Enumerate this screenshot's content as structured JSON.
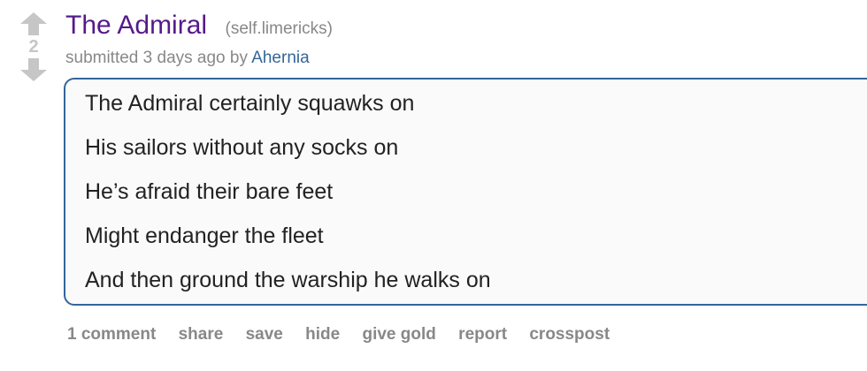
{
  "vote": {
    "score": "2"
  },
  "post": {
    "title": "The Admiral",
    "domain": "(self.limericks)",
    "tagline_prefix": "submitted 3 days ago by ",
    "author": "Ahernia"
  },
  "selftext": {
    "lines": [
      "The Admiral certainly squawks on",
      "His sailors without any socks on",
      "He’s afraid their bare feet",
      "Might endanger the fleet",
      "And then ground the warship he walks on"
    ]
  },
  "buttons": {
    "comments": "1 comment",
    "share": "share",
    "save": "save",
    "hide": "hide",
    "give_gold": "give gold",
    "report": "report",
    "crosspost": "crosspost"
  },
  "colors": {
    "title": "#551a8b",
    "author": "#336699",
    "muted": "#888888",
    "box_border": "#336699"
  }
}
